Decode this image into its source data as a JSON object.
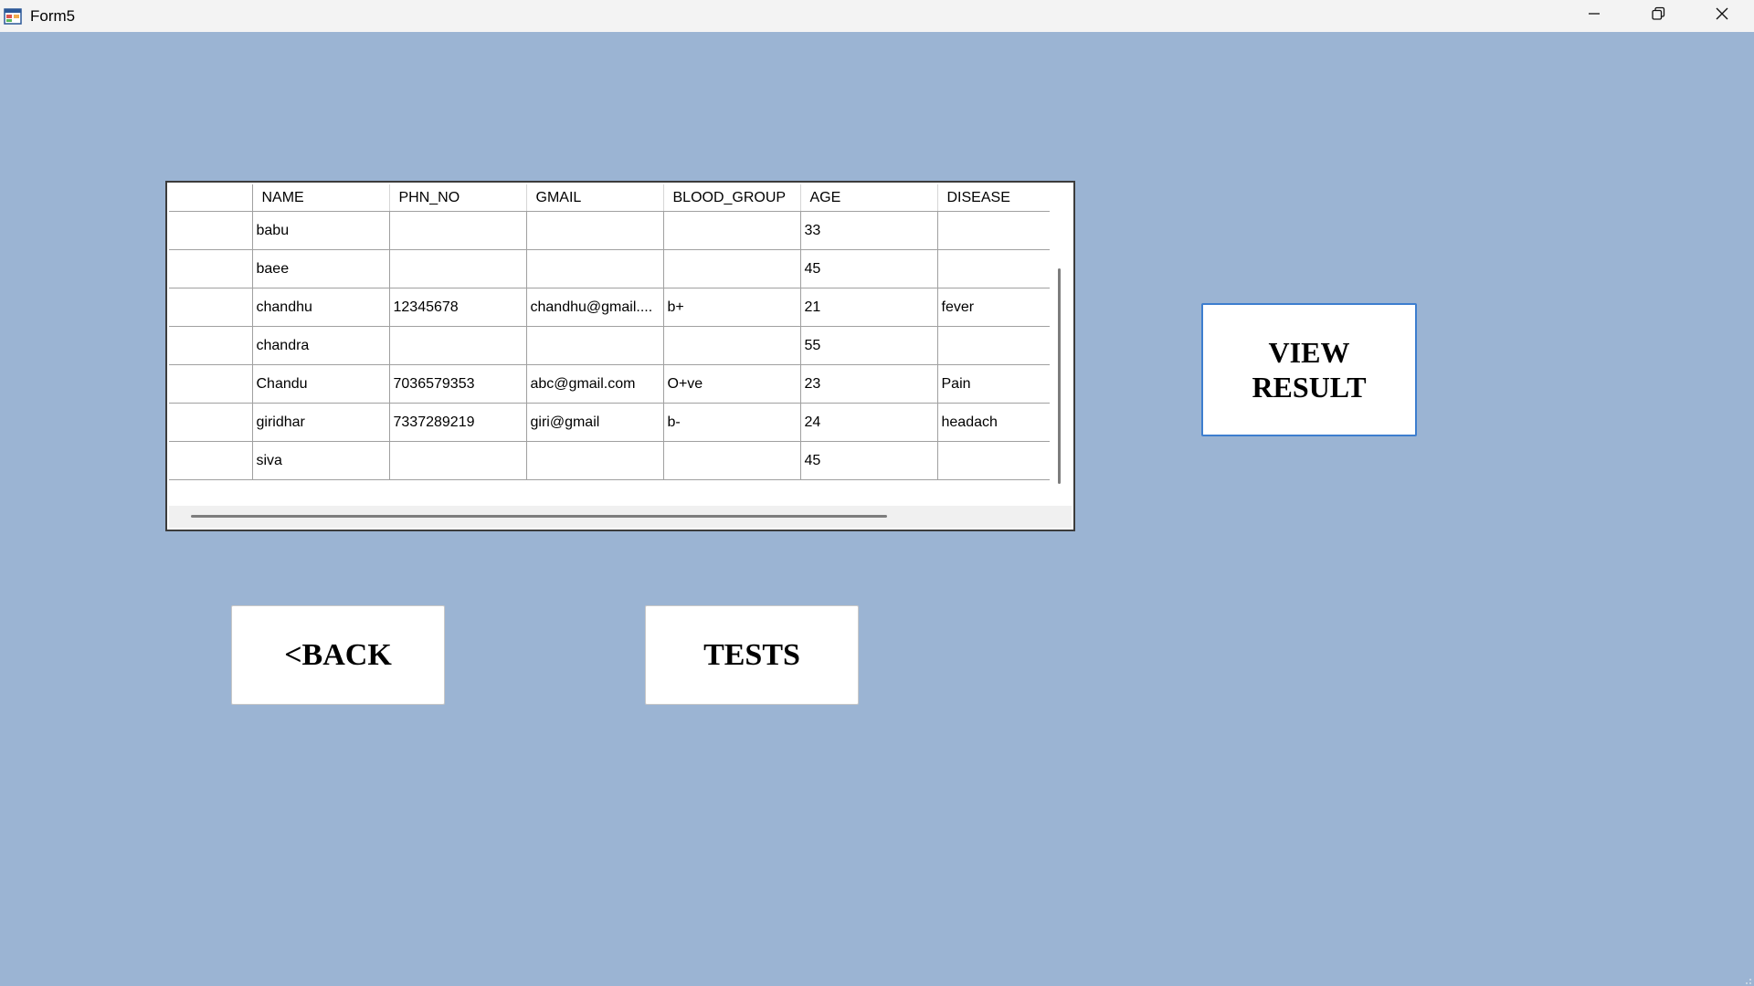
{
  "window": {
    "title": "Form5",
    "controls": [
      "minimize-icon",
      "restore-icon",
      "close-icon"
    ]
  },
  "grid": {
    "columns": [
      "NAME",
      "PHN_NO",
      "GMAIL",
      "BLOOD_GROUP",
      "AGE",
      "DISEASE"
    ],
    "rows": [
      [
        "babu",
        "",
        "",
        "",
        "33",
        ""
      ],
      [
        "baee",
        "",
        "",
        "",
        "45",
        ""
      ],
      [
        "chandhu",
        "12345678",
        "chandhu@gmail....",
        "b+",
        "21",
        "fever"
      ],
      [
        "chandra",
        "",
        "",
        "",
        "55",
        ""
      ],
      [
        "Chandu",
        "7036579353",
        "abc@gmail.com",
        "O+ve",
        "23",
        "Pain"
      ],
      [
        "giridhar",
        "7337289219",
        "giri@gmail",
        "b-",
        "24",
        "headach"
      ],
      [
        "siva",
        "",
        "",
        "",
        "45",
        ""
      ]
    ]
  },
  "buttons": {
    "view_result_line1": "VIEW",
    "view_result_line2": "RESULT",
    "back": "<BACK",
    "tests": "TESTS"
  },
  "colors": {
    "background": "#9bb4d3",
    "titlebar": "#f3f3f3",
    "focus_border": "#3d7ecf"
  }
}
